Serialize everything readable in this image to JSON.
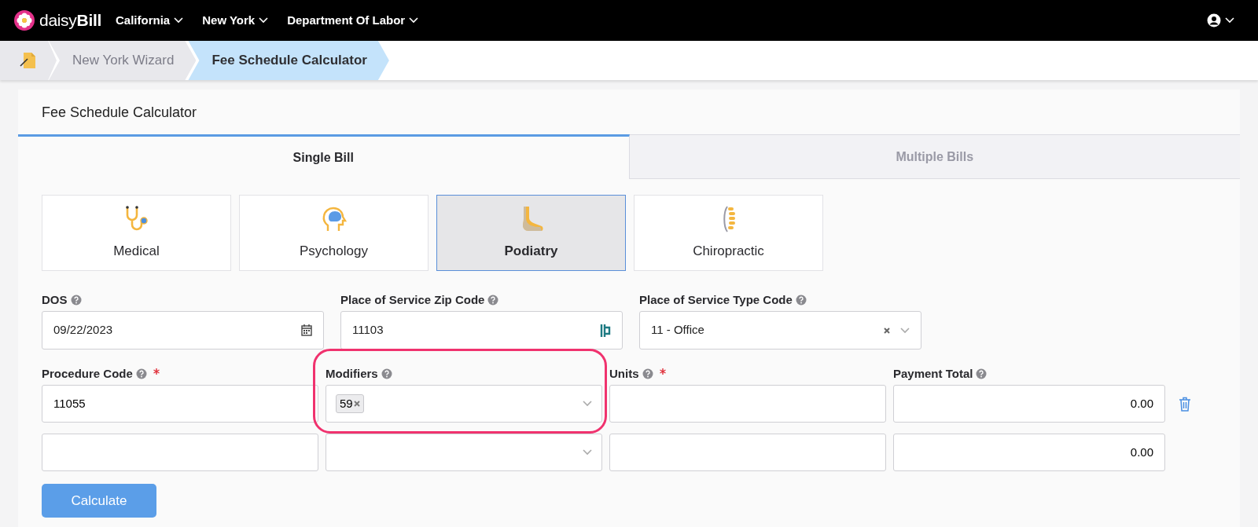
{
  "nav": {
    "brand_light": "daisy",
    "brand_bold": "Bill",
    "menus": [
      {
        "label": "California"
      },
      {
        "label": "New York"
      },
      {
        "label": "Department Of Labor"
      }
    ]
  },
  "breadcrumbs": [
    {
      "label": "New York Wizard",
      "selected": false
    },
    {
      "label": "Fee Schedule Calculator",
      "selected": true
    }
  ],
  "card": {
    "title": "Fee Schedule Calculator"
  },
  "tabs": [
    {
      "label": "Single Bill",
      "selected": true
    },
    {
      "label": "Multiple Bills",
      "selected": false
    }
  ],
  "specialties": [
    {
      "label": "Medical",
      "kind": "stethoscope",
      "selected": false
    },
    {
      "label": "Psychology",
      "kind": "brain",
      "selected": false
    },
    {
      "label": "Podiatry",
      "kind": "foot",
      "selected": true
    },
    {
      "label": "Chiropractic",
      "kind": "spine",
      "selected": false
    }
  ],
  "fields": [
    {
      "label": "DOS",
      "kind": "date",
      "value": "09/22/2023"
    },
    {
      "label": "Place of Service Zip Code",
      "kind": "zip",
      "value": "11103"
    },
    {
      "label": "Place of Service Type Code",
      "kind": "select",
      "value": "11 - Office"
    }
  ],
  "line_items": {
    "columns": [
      {
        "label": "Procedure Code",
        "required": true
      },
      {
        "label": "Modifiers",
        "required": false
      },
      {
        "label": "Units",
        "required": true
      },
      {
        "label": "Payment Total",
        "required": false
      }
    ],
    "rows": [
      {
        "procedure_code": "11055",
        "modifiers": [
          "59"
        ],
        "modifiers_highlighted": true,
        "payment_total": "0.00",
        "removable": true
      },
      {
        "modifiers_highlighted": false,
        "payment_total": "0.00",
        "removable": false
      }
    ]
  },
  "calculate_button": "Calculate"
}
